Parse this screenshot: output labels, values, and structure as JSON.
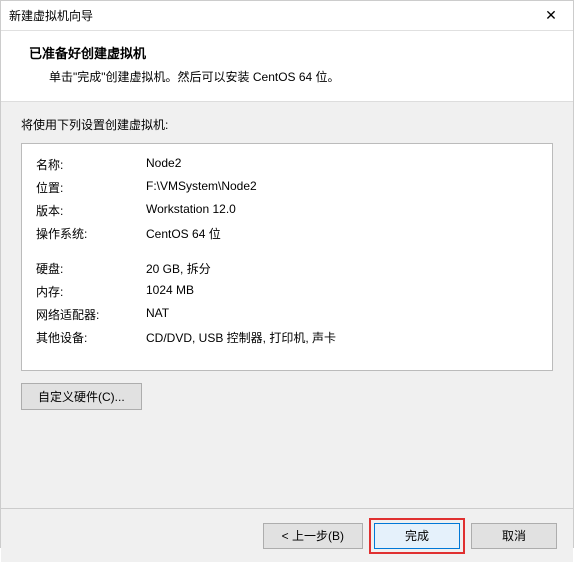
{
  "window": {
    "title": "新建虚拟机向导"
  },
  "header": {
    "heading": "已准备好创建虚拟机",
    "sub": "单击\"完成\"创建虚拟机。然后可以安装 CentOS 64 位。"
  },
  "body": {
    "intro": "将使用下列设置创建虚拟机:",
    "settings": {
      "name_label": "名称:",
      "name_value": "Node2",
      "location_label": "位置:",
      "location_value": "F:\\VMSystem\\Node2",
      "version_label": "版本:",
      "version_value": "Workstation 12.0",
      "os_label": "操作系统:",
      "os_value": "CentOS 64 位",
      "disk_label": "硬盘:",
      "disk_value": "20 GB, 拆分",
      "memory_label": "内存:",
      "memory_value": "1024 MB",
      "nic_label": "网络适配器:",
      "nic_value": "NAT",
      "other_label": "其他设备:",
      "other_value": "CD/DVD, USB 控制器, 打印机, 声卡"
    },
    "customize_button": "自定义硬件(C)..."
  },
  "footer": {
    "back": "< 上一步(B)",
    "finish": "完成",
    "cancel": "取消"
  }
}
